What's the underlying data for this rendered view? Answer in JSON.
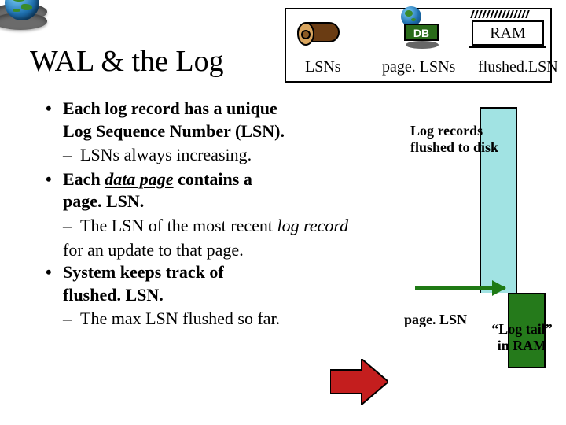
{
  "title": "WAL & the Log",
  "legend": {
    "lsns": "LSNs",
    "pagelsns": "page. LSNs",
    "flushedlsn": "flushed.LSN",
    "db": "DB",
    "ram": "RAM"
  },
  "bullets": {
    "b1_a": "Each log record has a unique",
    "b1_b": "Log Sequence Number (LSN).",
    "b1_sub": "LSNs always increasing.",
    "b2_a": "Each ",
    "b2_a_em": "data page",
    "b2_a2": " contains a",
    "b2_b": "page. LSN.",
    "b2_sub_a": "The LSN of the most recent ",
    "b2_sub_em": "log record",
    "b2_sub_c": "for an update to that page.",
    "b3_a": "System keeps track of",
    "b3_b": "flushed. LSN.",
    "b3_sub": "The max LSN flushed so far."
  },
  "annotations": {
    "log_flushed_a": "Log records",
    "log_flushed_b": "flushed to disk",
    "pagelsn": "page. LSN",
    "logtail_a": "“Log tail”",
    "logtail_b": "in RAM"
  }
}
